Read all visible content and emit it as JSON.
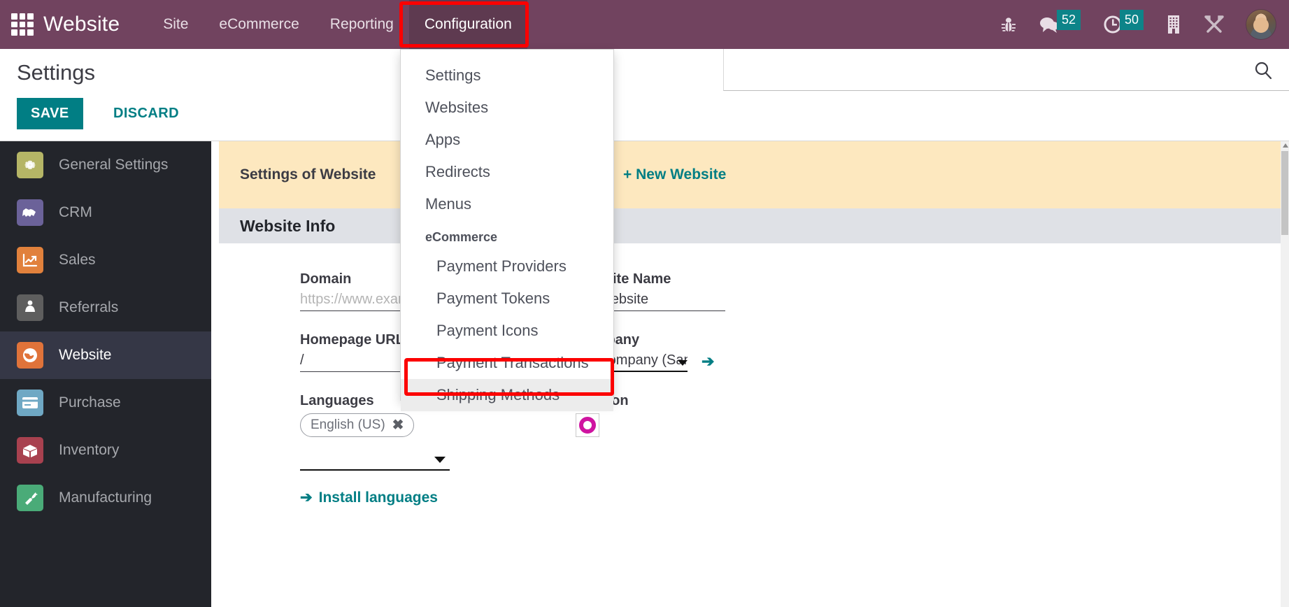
{
  "topbar": {
    "apps_icon": "apps-grid-icon",
    "brand": "Website",
    "nav": [
      {
        "label": "Site",
        "active": false
      },
      {
        "label": "eCommerce",
        "active": false
      },
      {
        "label": "Reporting",
        "active": false
      },
      {
        "label": "Configuration",
        "active": true
      }
    ],
    "sysicons": [
      {
        "name": "bug-icon",
        "glyph": "🐞",
        "badge": null
      },
      {
        "name": "messages-icon",
        "glyph": "💬",
        "badge": "52"
      },
      {
        "name": "activities-clock-icon",
        "glyph": "🕓",
        "badge": "50"
      },
      {
        "name": "company-building-icon",
        "glyph": "🏢",
        "badge": null
      },
      {
        "name": "developer-tools-icon",
        "glyph": "⚒",
        "badge": null
      }
    ],
    "avatar_name": "user-avatar"
  },
  "control_panel": {
    "title": "Settings",
    "save_label": "SAVE",
    "discard_label": "DISCARD",
    "search_placeholder": ""
  },
  "sidebar": {
    "items": [
      {
        "label": "General Settings",
        "icon": "gear-icon",
        "color": "#b5b566",
        "active": false
      },
      {
        "label": "CRM",
        "icon": "handshake-icon",
        "color": "#6b6299",
        "active": false
      },
      {
        "label": "Sales",
        "icon": "chart-up-icon",
        "color": "#e1813c",
        "active": false
      },
      {
        "label": "Referrals",
        "icon": "person-icon",
        "color": "#5e5e5e",
        "active": false
      },
      {
        "label": "Website",
        "icon": "globe-icon",
        "color": "#e0733a",
        "active": true
      },
      {
        "label": "Purchase",
        "icon": "card-icon",
        "color": "#6fa8c4",
        "active": false
      },
      {
        "label": "Inventory",
        "icon": "box-icon",
        "color": "#a8414f",
        "active": false
      },
      {
        "label": "Manufacturing",
        "icon": "wrench-icon",
        "color": "#4aab78",
        "active": false
      }
    ]
  },
  "main": {
    "banner_title": "Settings of Website",
    "new_website_label": "+ New Website",
    "section_title": "Website Info",
    "fields": {
      "domain_label": "Domain",
      "domain_placeholder": "https://www.example.com",
      "domain_value": "",
      "homepage_label": "Homepage URL",
      "homepage_value": "/",
      "languages_label": "Languages",
      "language_tag": "English (US)",
      "install_languages_label": "Install languages",
      "website_name_label": "Website Name",
      "website_name_value": "My Website",
      "company_label": "Company",
      "company_value": "My Company (San Francisco)",
      "favicon_label": "Favicon",
      "favicon_color": "#cf14a0"
    }
  },
  "dropdown": {
    "items": [
      {
        "label": "Settings",
        "type": "item"
      },
      {
        "label": "Websites",
        "type": "item"
      },
      {
        "label": "Apps",
        "type": "item"
      },
      {
        "label": "Redirects",
        "type": "item"
      },
      {
        "label": "Menus",
        "type": "item"
      },
      {
        "label": "eCommerce",
        "type": "section"
      },
      {
        "label": "Payment Providers",
        "type": "sub"
      },
      {
        "label": "Payment Tokens",
        "type": "sub"
      },
      {
        "label": "Payment Icons",
        "type": "sub"
      },
      {
        "label": "Payment Transactions",
        "type": "sub"
      },
      {
        "label": "Shipping Methods",
        "type": "sub",
        "selected": true
      }
    ]
  },
  "colors": {
    "brand_purple": "#71435f",
    "accent_teal": "#017e84",
    "highlight_red": "#fc0000",
    "banner_yellow": "#fde8bf",
    "sidebar_dark": "#23252b"
  }
}
